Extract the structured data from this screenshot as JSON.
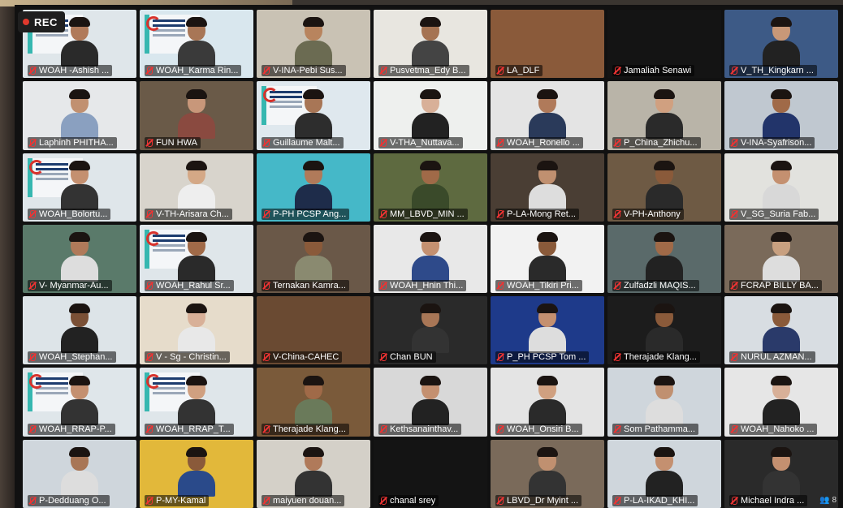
{
  "recording": {
    "label": "REC"
  },
  "participants_indicator": "8",
  "grid": {
    "columns": 7,
    "rows": 7,
    "tiles": [
      {
        "name": "WOAH -Ashish ...",
        "bg": "#dfe6ea",
        "skin": "#b07a5a",
        "shirt": "#2a2a2a",
        "slide": true,
        "person": true
      },
      {
        "name": "WOAH_Karma Rin...",
        "bg": "#d9e7ee",
        "skin": "#a87656",
        "shirt": "#3a3a3a",
        "slide": true,
        "person": true
      },
      {
        "name": "V-INA-Pebi Sus...",
        "bg": "#c9c2b4",
        "skin": "#b8845e",
        "shirt": "#6b6b52",
        "slide": false,
        "person": true
      },
      {
        "name": "Pusvetma_Edy B...",
        "bg": "#e8e6e0",
        "skin": "#a57352",
        "shirt": "#444",
        "slide": false,
        "person": true
      },
      {
        "name": "LA_DLF",
        "bg": "#8a5a3a",
        "skin": "#b07a5a",
        "shirt": "#c33",
        "slide": false,
        "person": false
      },
      {
        "name": "Jamaliah Senawi",
        "bg": "#141414",
        "skin": "",
        "shirt": "",
        "slide": false,
        "person": false
      },
      {
        "name": "V_TH_Kingkarn ...",
        "bg": "#3d5a86",
        "skin": "#c89878",
        "shirt": "#222",
        "slide": false,
        "person": true
      },
      {
        "name": "Laphinh PHITHA...",
        "bg": "#e6e8ea",
        "skin": "#c19070",
        "shirt": "#8aa0c0",
        "slide": false,
        "person": true
      },
      {
        "name": "FUN HWA",
        "bg": "#6a5a48",
        "skin": "#c8977a",
        "shirt": "#8a4a40",
        "slide": false,
        "person": true
      },
      {
        "name": "Guillaume Malt...",
        "bg": "#dfe8ee",
        "skin": "#a87656",
        "shirt": "#2d2d2d",
        "slide": true,
        "person": true
      },
      {
        "name": "V-THA_Nuttava...",
        "bg": "#eef0ee",
        "skin": "#d8b098",
        "shirt": "#222",
        "slide": false,
        "person": true
      },
      {
        "name": "WOAH_Ronello ...",
        "bg": "#e4e4e4",
        "skin": "#b07a5a",
        "shirt": "#2a3a5a",
        "slide": false,
        "person": true
      },
      {
        "name": "P_China_Zhichu...",
        "bg": "#b9b4a8",
        "skin": "#d0a080",
        "shirt": "#2a2a2a",
        "slide": false,
        "person": true
      },
      {
        "name": "V-INA-Syafrison...",
        "bg": "#c0c8d0",
        "skin": "#a06a48",
        "shirt": "#22346a",
        "slide": false,
        "person": true
      },
      {
        "name": "WOAH_Bolortu...",
        "bg": "#dfe6ea",
        "skin": "#c49070",
        "shirt": "#333",
        "slide": true,
        "person": true
      },
      {
        "name": "V-TH-Arisara Ch...",
        "bg": "#d8d4cc",
        "skin": "#d4a886",
        "shirt": "#eee",
        "slide": false,
        "person": true
      },
      {
        "name": "P-PH PCSP Ang...",
        "bg": "#45b8c8",
        "skin": "#b07a5a",
        "shirt": "#1e2c4a",
        "slide": false,
        "person": true
      },
      {
        "name": "MM_LBVD_MIN ...",
        "bg": "#5e6a40",
        "skin": "#a06a48",
        "shirt": "#3a4a2a",
        "slide": false,
        "person": true
      },
      {
        "name": "P-LA-Mong Ret...",
        "bg": "#4a3e34",
        "skin": "#c09070",
        "shirt": "#ddd",
        "slide": false,
        "person": true
      },
      {
        "name": "V-PH-Anthony",
        "bg": "#6e5a44",
        "skin": "#8a5a3a",
        "shirt": "#2a2a2a",
        "slide": false,
        "person": true
      },
      {
        "name": "V_SG_Suria Fab...",
        "bg": "#e2e2de",
        "skin": "#c49070",
        "shirt": "#d8d8d8",
        "slide": false,
        "person": true
      },
      {
        "name": "V- Myanmar-Au...",
        "bg": "#5a7a6a",
        "skin": "#b07a5a",
        "shirt": "#ddd",
        "slide": false,
        "person": true
      },
      {
        "name": "WOAH_Rahul Sr...",
        "bg": "#dfe6ea",
        "skin": "#a06a48",
        "shirt": "#2a2a2a",
        "slide": true,
        "person": true
      },
      {
        "name": "Ternakan Kamra...",
        "bg": "#6a5848",
        "skin": "#8a5a3a",
        "shirt": "#8a8a70",
        "slide": false,
        "person": true
      },
      {
        "name": "WOAH_Hnin Thi...",
        "bg": "#e8e8e8",
        "skin": "#c49070",
        "shirt": "#2e4a8a",
        "slide": false,
        "person": true
      },
      {
        "name": "WOAH_Tikiri Pri...",
        "bg": "#f2f2f2",
        "skin": "#8a5a3a",
        "shirt": "#2a2a2a",
        "slide": false,
        "person": true
      },
      {
        "name": "Zulfadzli MAQIS...",
        "bg": "#5a6a6a",
        "skin": "#a06a48",
        "shirt": "#222",
        "slide": false,
        "person": true
      },
      {
        "name": "FCRAP BILLY BA...",
        "bg": "#7a6a5a",
        "skin": "#c8a080",
        "shirt": "#ddd",
        "slide": false,
        "person": true
      },
      {
        "name": "WOAH_Stephan...",
        "bg": "#dde4e8",
        "skin": "#7a5036",
        "shirt": "#222",
        "slide": false,
        "person": true
      },
      {
        "name": "V - Sg - Christin...",
        "bg": "#e6dccb",
        "skin": "#d8b098",
        "shirt": "#e8e8e8",
        "slide": false,
        "person": true
      },
      {
        "name": "V-China-CAHEC",
        "bg": "#6a4a32",
        "skin": "#c09070",
        "shirt": "#333",
        "slide": false,
        "person": false
      },
      {
        "name": "Chan BUN",
        "bg": "#2a2a2a",
        "skin": "#a87656",
        "shirt": "#333",
        "slide": false,
        "person": true
      },
      {
        "name": "P_PH PCSP Tom ...",
        "bg": "#1e3a8a",
        "skin": "#c49070",
        "shirt": "#ddd",
        "slide": false,
        "person": true
      },
      {
        "name": "Therajade Klang...",
        "bg": "#1c1c1c",
        "skin": "#8a5a3a",
        "shirt": "#2a2a2a",
        "slide": false,
        "person": true
      },
      {
        "name": "NURUL AZMAN...",
        "bg": "#d8dde2",
        "skin": "#8a5a3a",
        "shirt": "#2a3a6a",
        "slide": false,
        "person": true
      },
      {
        "name": "WOAH_RRAP-P...",
        "bg": "#dfe6ea",
        "skin": "#c49070",
        "shirt": "#333",
        "slide": true,
        "person": true
      },
      {
        "name": "WOAH_RRAP_T...",
        "bg": "#dfe6ea",
        "skin": "#d0a080",
        "shirt": "#333",
        "slide": true,
        "person": true
      },
      {
        "name": "Therajade Klang...",
        "bg": "#7a5a3a",
        "skin": "#a06a48",
        "shirt": "#6a7a5a",
        "slide": false,
        "person": true
      },
      {
        "name": "Kethsanainthav...",
        "bg": "#d8d8d8",
        "skin": "#c49070",
        "shirt": "#222",
        "slide": false,
        "person": true
      },
      {
        "name": "WOAH_Onsiri B...",
        "bg": "#e4e4e4",
        "skin": "#d0a080",
        "shirt": "#2a2a2a",
        "slide": false,
        "person": true
      },
      {
        "name": "Som Pathamma...",
        "bg": "#cfd6dc",
        "skin": "#c09070",
        "shirt": "#ddd",
        "slide": false,
        "person": true
      },
      {
        "name": "WOAH_Nahoko ...",
        "bg": "#e6e6e6",
        "skin": "#d8b098",
        "shirt": "#222",
        "slide": false,
        "person": true
      },
      {
        "name": "P-Dedduang O...",
        "bg": "#cfd6dc",
        "skin": "#a87656",
        "shirt": "#ddd",
        "slide": false,
        "person": true
      },
      {
        "name": "P-MY-Kamal",
        "bg": "#e2b83a",
        "skin": "#8a5a3a",
        "shirt": "#2a4a8a",
        "slide": false,
        "person": true
      },
      {
        "name": "maiyuen douan...",
        "bg": "#d4d0c8",
        "skin": "#b07a5a",
        "shirt": "#333",
        "slide": false,
        "person": true
      },
      {
        "name": "chanal srey",
        "bg": "#141414",
        "skin": "",
        "shirt": "",
        "slide": false,
        "person": false
      },
      {
        "name": "LBVD_Dr Myint ...",
        "bg": "#7a6a5a",
        "skin": "#c09070",
        "shirt": "#333",
        "slide": false,
        "person": true
      },
      {
        "name": "P-LA-IKAD_KHI...",
        "bg": "#cfd6dc",
        "skin": "#c49070",
        "shirt": "#222",
        "slide": false,
        "person": true
      },
      {
        "name": "Michael Indra ...",
        "bg": "#2a2a2a",
        "skin": "#c49070",
        "shirt": "#333",
        "slide": false,
        "person": true
      }
    ]
  }
}
